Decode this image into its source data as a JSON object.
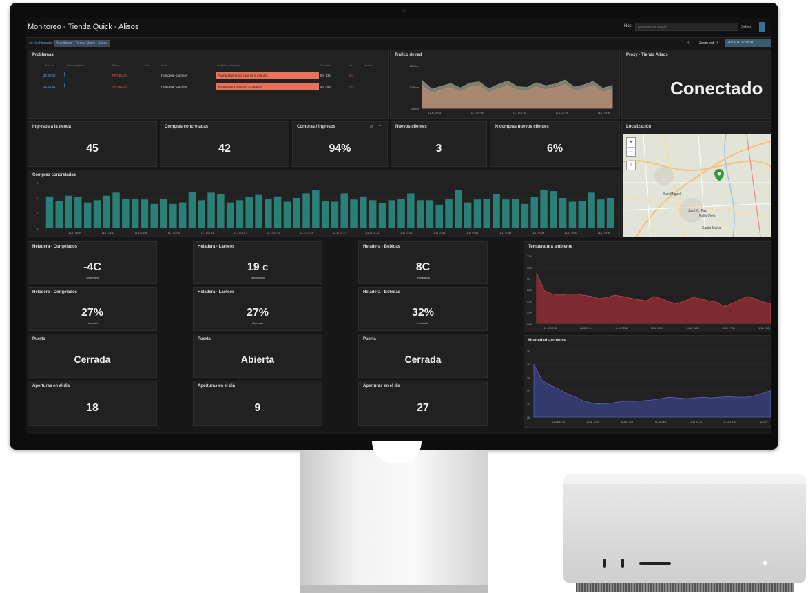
{
  "topbar": {
    "title": "Monitoreo - Tienda Quick - Alisos",
    "host_label": "Host",
    "host_placeholder": "type here to search",
    "select_label": "Select"
  },
  "breadcrumb": {
    "home": "All dashboards",
    "sep": "/",
    "current": "Monitoreo - Tienda Quick - Alisos"
  },
  "timepicker": {
    "zoom_out": "Zoom out",
    "range": "2023-11-17 08:40"
  },
  "problems": {
    "title": "Problemas",
    "columns": [
      "Time ▲",
      "Recovery time",
      "Status",
      "Info",
      "Host",
      "Problem • Severity",
      "Duration",
      "Ack",
      "Actions"
    ],
    "rows": [
      {
        "time": "21:32:05",
        "status": "PROBLEM",
        "host": "Heladera - Lacteos",
        "problem": "Puerta abierta por mas de 5 minutos",
        "duration": "5m 13s",
        "ack": "No"
      },
      {
        "time": "21:31:54",
        "status": "PROBLEM",
        "host": "Heladera - Lacteos",
        "problem": "Temperatura mayor a 10 grados",
        "duration": "5m 44s",
        "ack": "No"
      }
    ]
  },
  "traffic": {
    "title": "Trafico de red",
    "y_ticks": [
      "15 Kbps",
      "10 Kbps",
      "5 Kbps"
    ],
    "x_ticks": [
      "11-17 06:48",
      "11-17 07:06",
      "11-17 07:16",
      "11-17 07:26",
      "11-17 07:36"
    ]
  },
  "proxy": {
    "title": "Proxy - Tienda Alisos",
    "value": "Conectado"
  },
  "stats": [
    {
      "title": "Ingresos a la tienda",
      "value": "45"
    },
    {
      "title": "Compras concretadas",
      "value": "42"
    },
    {
      "title": "Compras / Ingresos",
      "value": "94%"
    },
    {
      "title": "Nuevos clientes",
      "value": "3"
    },
    {
      "title": "% compras nuevos clientes",
      "value": "6%"
    }
  ],
  "map": {
    "title": "Localización",
    "zoom_in": "+",
    "zoom_out": "−",
    "home": "⌂",
    "labels": [
      "San Miguel",
      "José C. Paz",
      "Bella Vista",
      "Santa María"
    ],
    "marker_icon": "map-marker-icon"
  },
  "compras_chart": {
    "title": "Compras concretadas",
    "y_ticks": [
      "6",
      "4",
      "2",
      "0"
    ],
    "x_ticks": [
      "11-17 06:49",
      "11-17 06:52",
      "11-17 06:56",
      "11-17 07:00",
      "11-17 07:03",
      "11-17 07:07",
      "11-17 07:10",
      "11-17 07:14",
      "11-17 07:17",
      "11-17 07:21",
      "11-17 07:24",
      "11-17 07:28",
      "11-17 07:32",
      "11-17 07:35",
      "11-17 07:39",
      "11-17 07:42",
      "11-17 07:46"
    ]
  },
  "fridges": [
    {
      "temp_title": "Heladera - Congelados",
      "temp_value": "-4C",
      "temp_unit": "",
      "temp_label": "Temperatura",
      "hum_title": "Heladera - Congelados",
      "hum_value": "27%",
      "hum_label": "Humedad",
      "door_title": "Puerta",
      "door_value": "Cerrada",
      "open_title": "Aperturas en el dia",
      "open_value": "18"
    },
    {
      "temp_title": "Heladera - Lacteos",
      "temp_value": "19",
      "temp_unit": "C",
      "temp_label": "Temperatura",
      "hum_title": "Heladera - Lacteos",
      "hum_value": "27%",
      "hum_label": "Humedad",
      "door_title": "Puerta",
      "door_value": "Abierta",
      "open_title": "Aperturas en el dia",
      "open_value": "9"
    },
    {
      "temp_title": "Heladera - Bebidas",
      "temp_value": "8C",
      "temp_unit": "",
      "temp_label": "Temperatura",
      "hum_title": "Heladera - Bebidas",
      "hum_value": "32%",
      "hum_label": "Humedad",
      "door_title": "Puerta",
      "door_value": "Cerrada",
      "open_title": "Aperturas en el dia",
      "open_value": "27"
    }
  ],
  "temp_chart": {
    "title": "Temperatura ambiente",
    "y_ticks": [
      "23.4",
      "23.2",
      "23",
      "22.8",
      "22.6",
      "22.4",
      "22.2"
    ],
    "x_ticks": [
      "11-18 10:38",
      "11-18 12:04",
      "11-18 13:32",
      "11-18 15:02",
      "11-18 16:30",
      "11-18 17:58",
      "11-18 19:26"
    ]
  },
  "hum_chart": {
    "title": "Humedad ambiente",
    "y_ticks": [
      "38",
      "36",
      "34",
      "32",
      "30",
      "28"
    ],
    "x_ticks": [
      "11-18 11:36",
      "11-18 12:54",
      "11-18 14:21",
      "11-18 15:47",
      "11-18 17:14",
      "11-18 18:40",
      "11-18 2"
    ]
  },
  "chart_data": [
    {
      "type": "area",
      "title": "Trafico de red",
      "ylabel": "",
      "ylim": [
        5,
        15
      ],
      "series": [
        {
          "values": [
            11.5,
            9.5,
            10.2,
            10.8,
            9.8,
            10.9,
            11.2,
            9.6,
            10.6,
            11.4,
            10.1,
            9.9,
            11.0,
            10.3,
            10.7,
            11.6,
            10.0,
            10.5,
            11.3,
            9.7,
            10.4
          ]
        },
        {
          "values": [
            10.2,
            8.6,
            9.3,
            9.8,
            8.9,
            10.0,
            10.3,
            8.7,
            9.6,
            10.4,
            9.2,
            9.0,
            10.1,
            9.4,
            9.8,
            10.6,
            9.1,
            9.6,
            10.3,
            8.8,
            9.5
          ]
        }
      ]
    },
    {
      "type": "bar",
      "title": "Compras concretadas",
      "ylim": [
        0,
        6
      ],
      "values": [
        4.2,
        3.6,
        4.3,
        4.1,
        3.4,
        3.7,
        4.3,
        4.7,
        3.9,
        3.9,
        3.8,
        3.2,
        3.9,
        3.2,
        3.4,
        4.8,
        3.7,
        4.7,
        4.5,
        3.4,
        3.7,
        4.1,
        4.4,
        3.9,
        4.2,
        3.5,
        4.0,
        4.6,
        5.0,
        3.6,
        3.5,
        4.6,
        3.8,
        4.2,
        3.7,
        3.3,
        3.7,
        3.9,
        4.6,
        3.7,
        3.7,
        3.1,
        3.9,
        5.0,
        3.4,
        3.8,
        3.9,
        4.5,
        3.8,
        3.9,
        3.2,
        4.1,
        5.1,
        4.9,
        4.0,
        3.5,
        3.6,
        4.7,
        3.8,
        4.0
      ]
    },
    {
      "type": "area",
      "title": "Temperatura ambiente",
      "ylim": [
        22.2,
        23.4
      ],
      "values": [
        23.1,
        22.78,
        22.72,
        22.7,
        22.72,
        22.72,
        22.7,
        22.68,
        22.64,
        22.66,
        22.7,
        22.68,
        22.65,
        22.62,
        22.6,
        22.68,
        22.64,
        22.58,
        22.55,
        22.6,
        22.66,
        22.64,
        22.6,
        22.58,
        22.5,
        22.55,
        22.62,
        22.68,
        22.64,
        22.58,
        22.55
      ]
    },
    {
      "type": "area",
      "title": "Humedad ambiente",
      "ylim": [
        28,
        38
      ],
      "values": [
        36,
        33.5,
        32.8,
        32.2,
        31.5,
        31,
        30.4,
        30.1,
        30.0,
        30.1,
        30.3,
        30.4,
        30.4,
        30.5,
        30.6,
        30.8,
        31.0,
        30.9,
        30.8,
        30.9,
        31.0,
        30.9,
        31.0,
        31.1,
        31.0,
        31.0,
        31.2,
        31.6,
        32.0
      ]
    }
  ]
}
